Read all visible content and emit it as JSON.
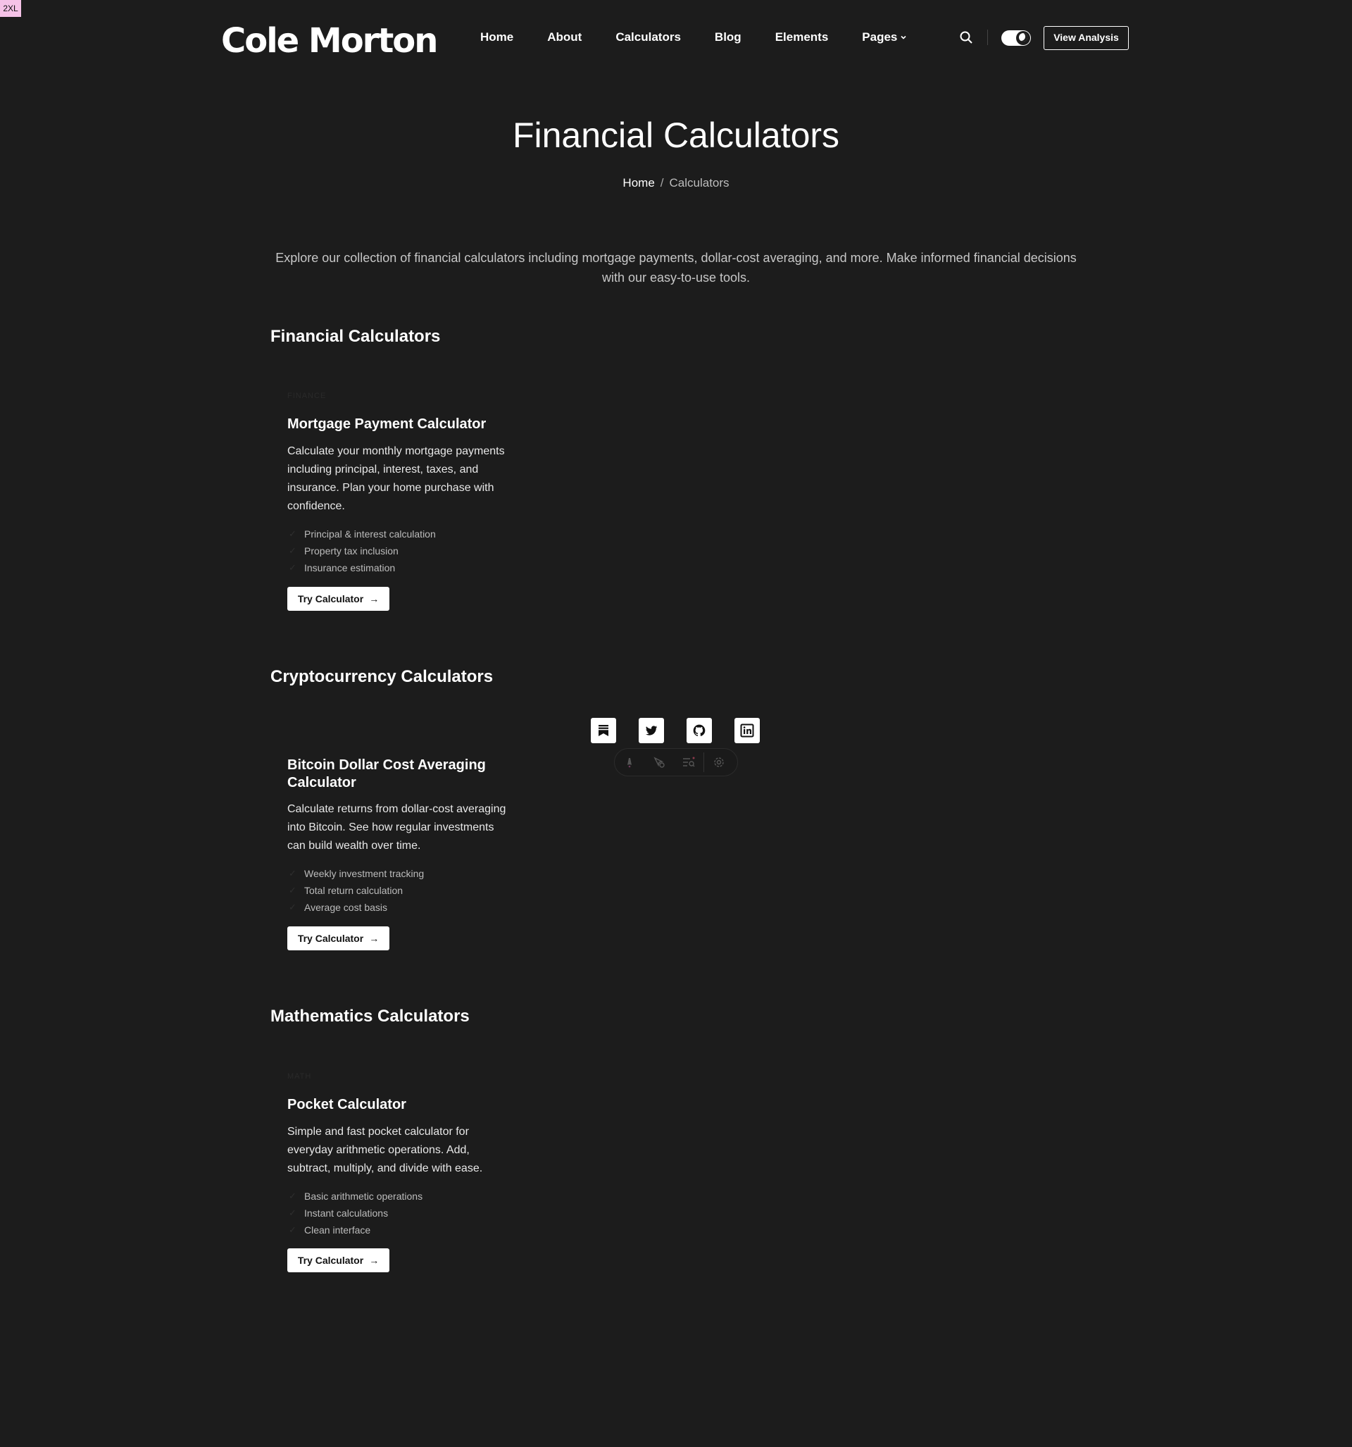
{
  "breakpoint_badge": "2XL",
  "header": {
    "logo": "Cole Morton",
    "nav": [
      "Home",
      "About",
      "Calculators",
      "Blog",
      "Elements",
      "Pages"
    ],
    "cta": "View Analysis"
  },
  "hero": {
    "title": "Financial Calculators",
    "breadcrumb": {
      "home": "Home",
      "separator": "/",
      "current": "Calculators"
    }
  },
  "intro": "Explore our collection of financial calculators including mortgage payments, dollar-cost averaging, and more. Make informed financial decisions with our easy-to-use tools.",
  "sections": [
    {
      "title": "Financial Calculators",
      "card": {
        "category": "FINANCE",
        "title": "Mortgage Payment Calculator",
        "description": "Calculate your monthly mortgage payments including principal, interest, taxes, and insurance. Plan your home purchase with confidence.",
        "features": [
          "Principal & interest calculation",
          "Property tax inclusion",
          "Insurance estimation"
        ],
        "button": "Try Calculator"
      }
    },
    {
      "title": "Cryptocurrency Calculators",
      "card": {
        "category": "",
        "title": "Bitcoin Dollar Cost Averaging Calculator",
        "description": "Calculate returns from dollar-cost averaging into Bitcoin. See how regular investments can build wealth over time.",
        "features": [
          "Weekly investment tracking",
          "Total return calculation",
          "Average cost basis"
        ],
        "button": "Try Calculator"
      }
    },
    {
      "title": "Mathematics Calculators",
      "card": {
        "category": "MATH",
        "title": "Pocket Calculator",
        "description": "Simple and fast pocket calculator for everyday arithmetic operations. Add, subtract, multiply, and divide with ease.",
        "features": [
          "Basic arithmetic operations",
          "Instant calculations",
          "Clean interface"
        ],
        "button": "Try Calculator"
      }
    }
  ],
  "social_icons": [
    "bookmark-icon",
    "twitter-icon",
    "github-icon",
    "linkedin-icon"
  ],
  "colors": {
    "background": "#1c1c1c",
    "text": "#ffffff",
    "muted": "#bcbcbc"
  }
}
